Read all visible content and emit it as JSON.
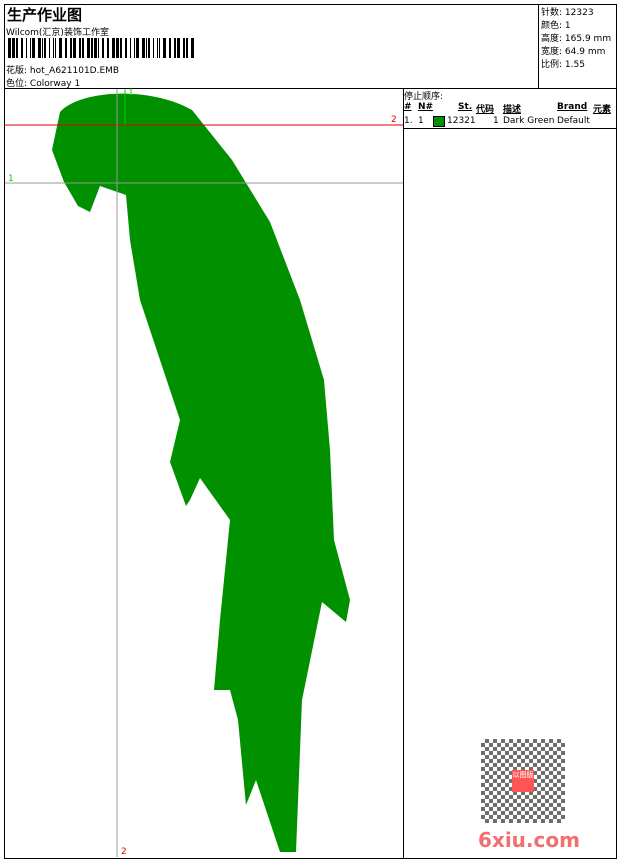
{
  "header": {
    "title": "生产作业图",
    "company": "Wilcom(汇京)装饰工作室",
    "design_label": "花版:",
    "design_value": "hot_A621101D.EMB",
    "colorway_label": "色位:",
    "colorway_value": "Colorway 1"
  },
  "stats": [
    {
      "label": "针数:",
      "value": "12323"
    },
    {
      "label": "颜色:",
      "value": "1"
    },
    {
      "label": "高度:",
      "value": "165.9 mm"
    },
    {
      "label": "宽度:",
      "value": "64.9 mm"
    },
    {
      "label": "比例:",
      "value": "1.55"
    }
  ],
  "stop_sequence": {
    "title": "停止顺序:",
    "columns": [
      "#",
      "N#",
      "St.",
      "代码",
      "描述",
      "Brand",
      "元素"
    ],
    "rows": [
      {
        "index": "1.",
        "needle": "1",
        "color": "#009000",
        "stitches": "12321",
        "code": "1",
        "description": "Dark Green",
        "brand": "Default",
        "element": ""
      }
    ]
  },
  "guides": {
    "h_red": "2",
    "h_gray": "1",
    "v_top": "1",
    "v_bottom": "2"
  },
  "watermark": {
    "text": "6xiu.com",
    "seal": "以图版"
  },
  "colors": {
    "thread": "#009000",
    "guide_red": "#e00000",
    "guide_green": "#00d000"
  }
}
